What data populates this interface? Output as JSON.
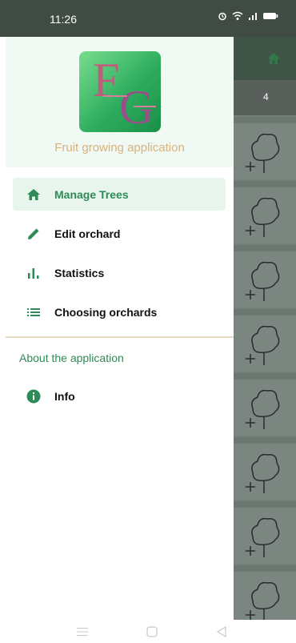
{
  "status": {
    "time": "11:26"
  },
  "backdrop": {
    "count": "4"
  },
  "drawer": {
    "app_name": "Fruit growing application",
    "logo_letters": "FG",
    "items": [
      {
        "label": "Manage Trees",
        "icon": "home-icon",
        "active": true
      },
      {
        "label": "Edit orchard",
        "icon": "pencil-icon"
      },
      {
        "label": "Statistics",
        "icon": "bar-chart-icon"
      },
      {
        "label": "Choosing orchards",
        "icon": "list-icon"
      }
    ],
    "section_title": "About the application",
    "info": {
      "label": "Info",
      "icon": "info-icon"
    }
  },
  "colors": {
    "accent": "#2e8b57",
    "status_bar": "#3f4b43",
    "header_bg": "#f1f9f4",
    "app_name": "#d8b27e"
  }
}
